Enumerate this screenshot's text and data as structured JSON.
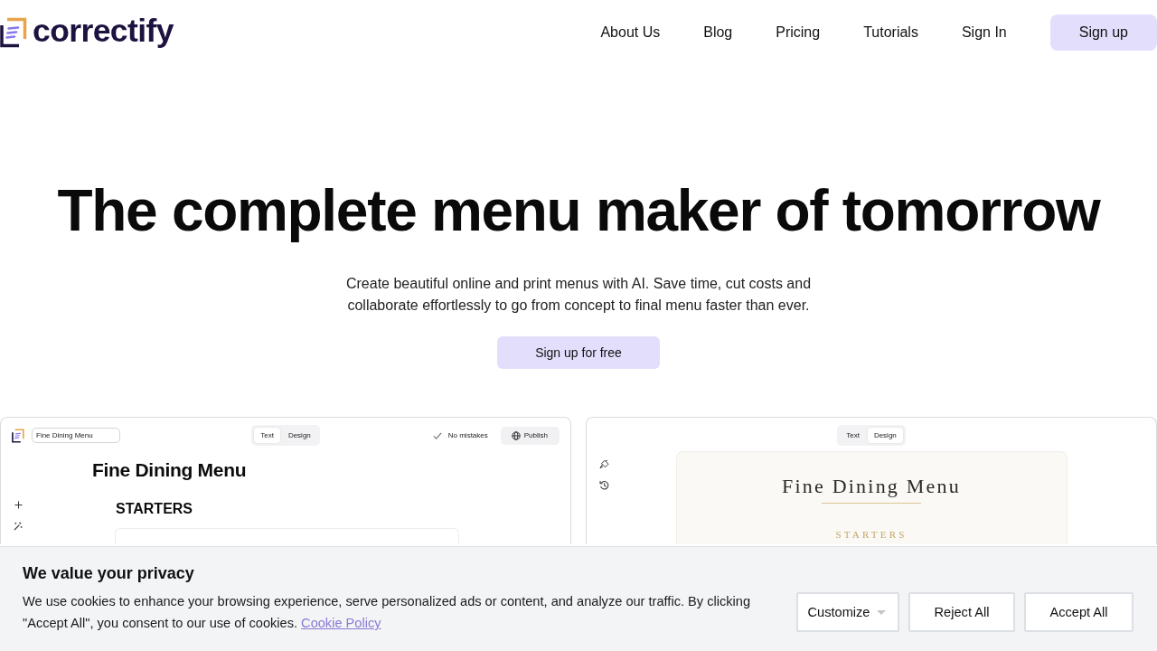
{
  "header": {
    "logo_text": "correctify",
    "nav_links": [
      "About Us",
      "Blog",
      "Pricing",
      "Tutorials",
      "Sign In"
    ],
    "signup_button": "Sign up"
  },
  "hero": {
    "title": "The complete menu maker of tomorrow",
    "subtitle": "Create beautiful online and print menus with AI. Save time, cut costs and collaborate effortlessly to go from concept to final menu faster than ever.",
    "cta_button": "Sign up for free"
  },
  "previews": [
    {
      "kind": "editor",
      "doc_name": "Fine Dining Menu",
      "tabs": [
        {
          "label": "Text",
          "selected": true
        },
        {
          "label": "Design",
          "selected": false
        }
      ],
      "status": "No mistakes",
      "publish_button": "Publish",
      "heading": "Fine Dining Menu",
      "section": "STARTERS"
    },
    {
      "kind": "design",
      "tabs": [
        {
          "label": "Text",
          "selected": false
        },
        {
          "label": "Design",
          "selected": true
        }
      ],
      "heading": "Fine Dining Menu",
      "section": "STARTERS"
    }
  ],
  "cookie_banner": {
    "title": "We value your privacy",
    "text": "We use cookies to enhance your browsing experience, serve personalized ads or content, and analyze our traffic. By clicking \"Accept All\", you consent to our use of cookies.",
    "link": "Cookie Policy",
    "buttons": [
      {
        "label": "Customize",
        "kind": "dropdown"
      },
      {
        "label": "Reject All",
        "kind": "plain"
      },
      {
        "label": "Accept All",
        "kind": "plain"
      }
    ]
  }
}
